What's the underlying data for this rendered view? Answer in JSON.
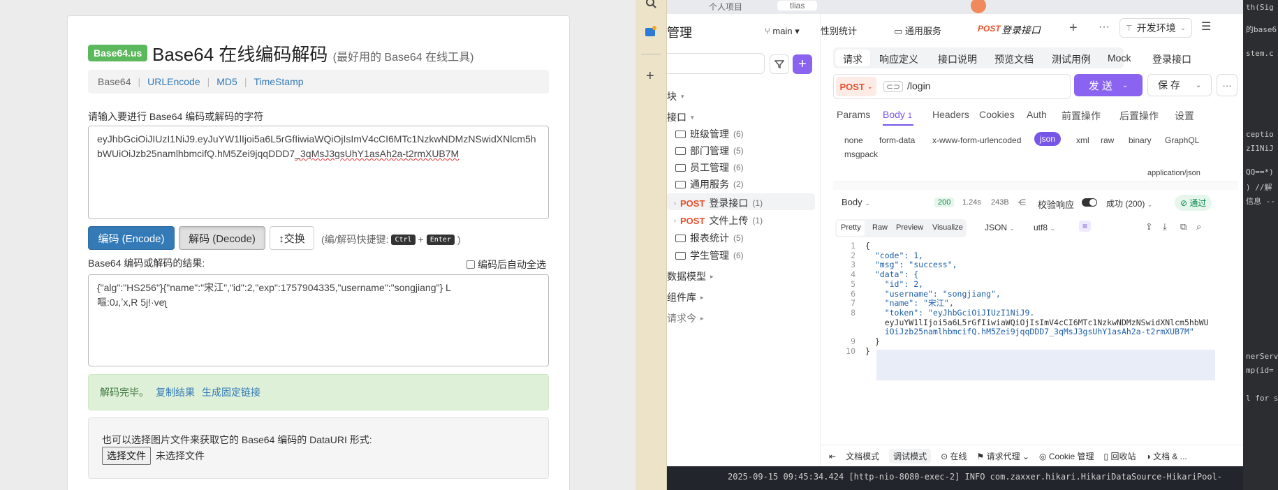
{
  "base64_page": {
    "brand": "Base64.us",
    "title": "Base64 在线编码解码",
    "subtitle": "(最好用的 Base64 在线工具)",
    "nav": [
      "Base64",
      "URLEncode",
      "MD5",
      "TimeStamp"
    ],
    "input_label": "请输入要进行 Base64 编码或解码的字符",
    "input_value_a": "eyJhbGciOiJIUzI1NiJ9.eyJuYW1lIjoi5a6L5rGfIiwiaWQiOjIsImV4cCI6MTc1NzkwNDMzNSwidXNlcm5hbWUiOiJzb25namlhbmcifQ.hM5Zei9jqqDDD7",
    "input_value_b": "_3qMsJ3gsUhY1asAh2a-t2rmXUB7M",
    "encode_button": "编码 (Encode)",
    "decode_button": "解码 (Decode)",
    "swap_button": "↕交换",
    "shortcut_prefix": "(编/解码快捷键:",
    "shortcut_key1": "Ctrl",
    "shortcut_plus": "+",
    "shortcut_key2": "Enter",
    "shortcut_suffix": ")",
    "output_label": "Base64 编码或解码的结果:",
    "auto_select_label": "编码后自动全选",
    "output_line1": "{\"alg\":\"HS256\"}{\"name\":\"宋江\",\"id\":2,\"exp\":1757904335,\"username\":\"songjiang\"}   L",
    "output_line2": "嘔:0ɹ,ʼx,R   5j!·veʅ",
    "success_text": "解码完毕。",
    "copy_link": "复制结果",
    "fixed_link": "生成固定链接",
    "file_hint": "也可以选择图片文件来获取它的 Base64 编码的 DataURI 形式:",
    "file_button": "选择文件",
    "file_status": "未选择文件"
  },
  "apifox": {
    "top_tabs": [
      "个人项目",
      "tlias"
    ],
    "header_title": "管理",
    "branch": "main",
    "tabs": [
      "性别统计",
      "通用服务",
      "登录接口"
    ],
    "active_tab_method": "POST",
    "environment": "开发环境",
    "tree": {
      "module_label": "块",
      "interfaces_label": "接口",
      "folders": [
        {
          "name": "班级管理",
          "count": "(6)"
        },
        {
          "name": "部门管理",
          "count": "(5)"
        },
        {
          "name": "员工管理",
          "count": "(6)"
        },
        {
          "name": "通用服务",
          "count": "(2)"
        }
      ],
      "endpoints": [
        {
          "method": "POST",
          "name": "登录接口",
          "count": "(1)"
        },
        {
          "method": "POST",
          "name": "文件上传",
          "count": "(1)"
        }
      ],
      "folders2": [
        {
          "name": "报表统计",
          "count": "(5)"
        },
        {
          "name": "学生管理",
          "count": "(6)"
        }
      ],
      "data_models": "数据模型",
      "components": "组件库",
      "requests": "请求今"
    },
    "sub_tabs": [
      "请求",
      "响应定义",
      "接口说明",
      "预览文档",
      "测试用例",
      "Mock"
    ],
    "sub_tab_title": "登录接口",
    "request": {
      "method": "POST",
      "url": "/login",
      "send": "发 送",
      "save": "保 存"
    },
    "param_tabs": [
      "Params",
      "Body",
      "Headers",
      "Cookies",
      "Auth",
      "前置操作",
      "后置操作",
      "设置"
    ],
    "body_count": "1",
    "body_types": [
      "none",
      "form-data",
      "x-www-form-urlencoded",
      "json",
      "xml",
      "raw",
      "binary",
      "GraphQL",
      "msgpack"
    ],
    "content_type": "application/json",
    "response": {
      "body_label": "Body",
      "status": "200",
      "time": "1.24s",
      "size": "243B",
      "validate_label": "校验响应",
      "success_label": "成功 (200)",
      "pass_label": "通过",
      "view_tabs": [
        "Pretty",
        "Raw",
        "Preview",
        "Visualize"
      ],
      "format": "JSON",
      "encoding": "utf8"
    },
    "json_lines": [
      {
        "n": "1",
        "t": "{"
      },
      {
        "n": "2",
        "t": "  \"code\": 1,"
      },
      {
        "n": "3",
        "t": "  \"msg\": \"success\","
      },
      {
        "n": "4",
        "t": "  \"data\": {"
      },
      {
        "n": "5",
        "t": "    \"id\": 2,"
      },
      {
        "n": "6",
        "t": "    \"username\": \"songjiang\","
      },
      {
        "n": "7",
        "t": "    \"name\": \"宋江\","
      },
      {
        "n": "8",
        "t": "    \"token\": \"eyJhbGciOiJIUzI1NiJ9."
      },
      {
        "n": "",
        "t": "    eyJuYW1lIjoi5a6L5rGfIiwiaWQiOjIsImV4cCI6MTc1NzkwNDMzNSwidXNlcm5hbWU"
      },
      {
        "n": "",
        "t": "    iOiJzb25namlhbmcifQ.hM5Zei9jqqDDD7_3qMsJ3gsUhY1asAh2a-t2rmXUB7M\""
      },
      {
        "n": "9",
        "t": "  }"
      },
      {
        "n": "10",
        "t": "}"
      }
    ],
    "footer": [
      "文档模式",
      "调试模式",
      "在线",
      "请求代理",
      "Cookie 管理",
      "回收站",
      "文档 & ..."
    ],
    "console": "2025-09-15 09:45:34.424 [http-nio-8080-exec-2] INFO  com.zaxxer.hikari.HikariDataSource-HikariPool-"
  },
  "editor_fragments": [
    "th(Sig",
    "的base6",
    "stem.c",
    "ceptio",
    "zI1NiJ",
    "QQ==*)",
    ")  //解",
    "信息 --",
    "nerServ",
    "mp(id=",
    "l for s"
  ]
}
